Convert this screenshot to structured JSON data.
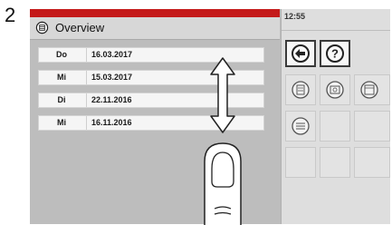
{
  "step": {
    "number": "2"
  },
  "header": {
    "title": "Overview",
    "icon": "overview-icon"
  },
  "list": {
    "rows": [
      {
        "day": "Do",
        "date": "16.03.2017"
      },
      {
        "day": "Mi",
        "date": "15.03.2017"
      },
      {
        "day": "Di",
        "date": "22.11.2016"
      },
      {
        "day": "Mi",
        "date": "16.11.2016"
      }
    ]
  },
  "status": {
    "time": "12:55"
  },
  "toolbar": {
    "back_icon": "arrow-left-icon",
    "help_icon": "question-icon"
  },
  "gesture": {
    "type": "vertical-swipe",
    "icons": [
      "double-arrow-vertical-icon",
      "finger-icon"
    ]
  },
  "colors": {
    "accent_bar": "#c41919",
    "panel_bg": "#bdbdbd",
    "row_bg": "#f5f5f5"
  }
}
